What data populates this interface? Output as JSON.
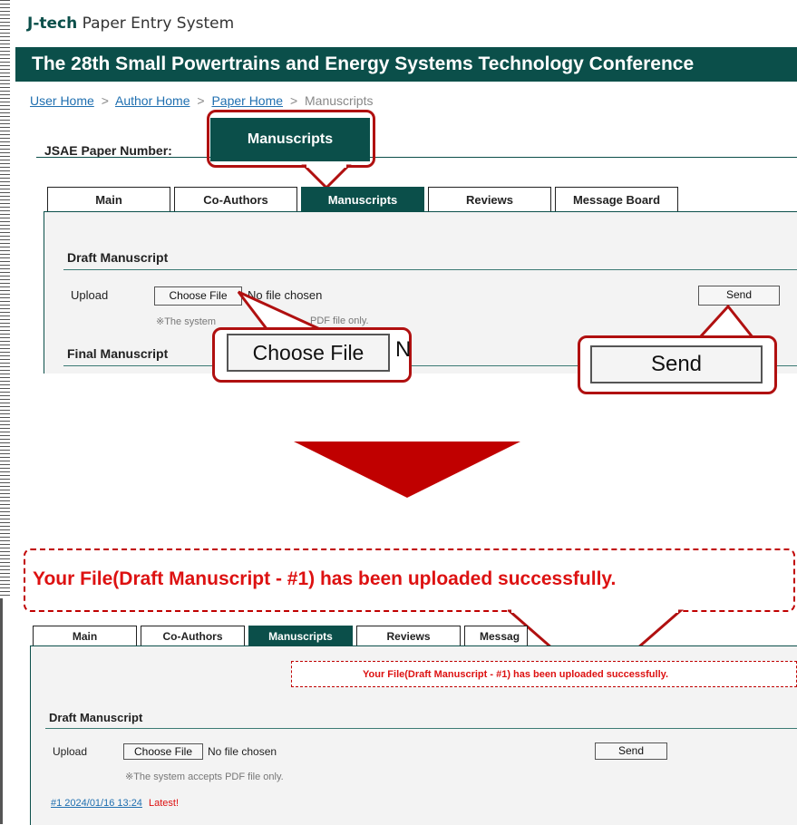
{
  "brand": {
    "prefix": "J-tech",
    "rest": "Paper Entry System"
  },
  "conference": "The 28th Small Powertrains and Energy Systems Technology Conference",
  "breadcrumb": {
    "items": [
      "User Home",
      "Author Home",
      "Paper Home"
    ],
    "current": "Manuscripts",
    "separator": ">"
  },
  "paper_number_label": "JSAE Paper Number:",
  "big_tab_label": "Manuscripts",
  "tabs": [
    "Main",
    "Co-Authors",
    "Manuscripts",
    "Reviews",
    "Message Board"
  ],
  "tabs_bottom_partial": "Messag",
  "draft": {
    "title": "Draft Manuscript",
    "upload_label": "Upload",
    "choose_file": "Choose File",
    "no_file": "No file chosen",
    "send": "Send",
    "note_partial_1": "※The system",
    "note_partial_2": "PDF file only.",
    "note_full": "※The system accepts PDF file only."
  },
  "final": {
    "title": "Final Manuscript"
  },
  "zoom": {
    "choose_file": "Choose File",
    "send": "Send",
    "choose_file_tail": "N"
  },
  "success_message": "Your File(Draft Manuscript - #1) has been uploaded successfully.",
  "history": {
    "link": "#1 2024/01/16 13:24",
    "latest": "Latest!"
  },
  "colors": {
    "accent": "#0b4f4a",
    "callout": "#b01010",
    "alert": "#c00000"
  }
}
